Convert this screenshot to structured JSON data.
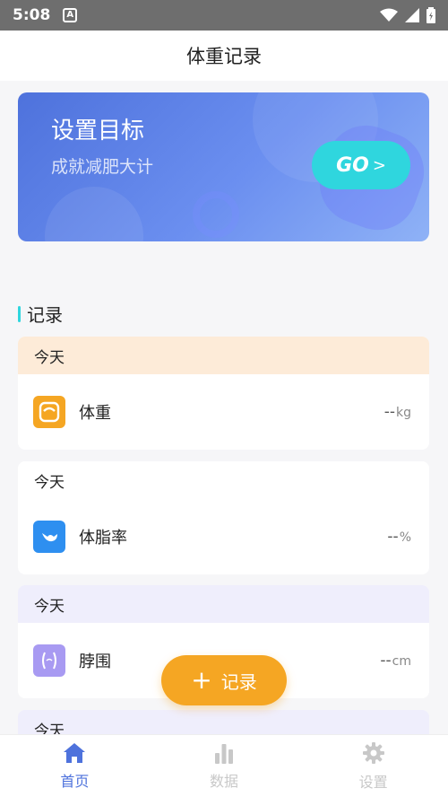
{
  "status_bar": {
    "time": "5:08",
    "notification_icon_text": "A"
  },
  "header": {
    "title": "体重记录"
  },
  "banner": {
    "title": "设置目标",
    "subtitle": "成就减肥大计",
    "go_label": "GO",
    "go_chevron": ">"
  },
  "section": {
    "title": "记录"
  },
  "records": [
    {
      "day": "今天",
      "name": "体重",
      "value": "--",
      "unit": "kg",
      "day_bg": "#fdebd8",
      "icon": "weight-scale-icon",
      "icon_color": "#f5a623"
    },
    {
      "day": "今天",
      "name": "体脂率",
      "value": "--",
      "unit": "%",
      "day_bg": "#ffffff",
      "icon": "body-fat-icon",
      "icon_color": "#2e8ff0"
    },
    {
      "day": "今天",
      "name": "脖围",
      "value": "--",
      "unit": "cm",
      "day_bg": "#efeefc",
      "icon": "neck-icon",
      "icon_color": "#a89af2"
    },
    {
      "day": "今天"
    }
  ],
  "fab": {
    "plus": "+",
    "label": "记录"
  },
  "tabs": [
    {
      "label": "首页",
      "icon": "home-icon",
      "active": true
    },
    {
      "label": "数据",
      "icon": "bar-chart-icon",
      "active": false
    },
    {
      "label": "设置",
      "icon": "gear-icon",
      "active": false
    }
  ],
  "colors": {
    "accent": "#4e72dc",
    "go": "#2fd6de",
    "fab": "#f5a623",
    "tab_active": "#4e72dc",
    "tab_inactive": "#c8c8c8"
  }
}
